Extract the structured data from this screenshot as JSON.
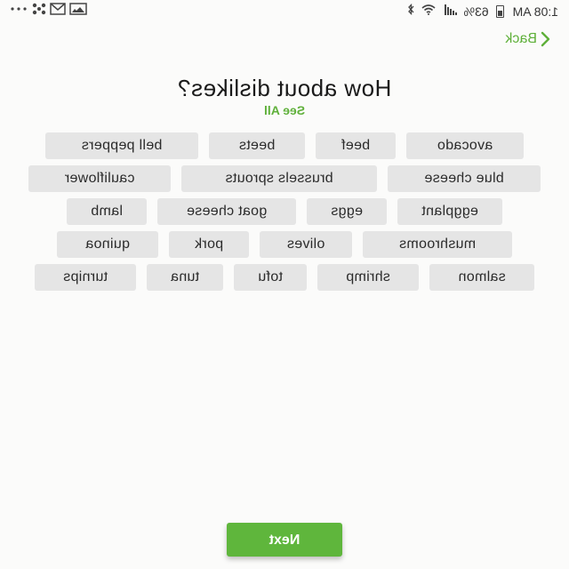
{
  "status_bar": {
    "time": "1:08 AM",
    "battery_percent": "63%",
    "icons": [
      "bluetooth-icon",
      "wifi-icon",
      "signal-icon",
      "battery-icon",
      "gallery-icon",
      "mail-icon",
      "pinwheel-icon",
      "more-icon"
    ]
  },
  "header": {
    "back_label": "Back"
  },
  "title": "How about dislikes?",
  "see_all_label": "See All",
  "chips": [
    "avocado",
    "beef",
    "beets",
    "bell peppers",
    "blue cheese",
    "brussels sprouts",
    "cauliflower",
    "eggplant",
    "eggs",
    "goat cheese",
    "lamb",
    "mushrooms",
    "olives",
    "pork",
    "quinoa",
    "salmon",
    "shrimp",
    "tofu",
    "tuna",
    "turnips"
  ],
  "next_label": "Next",
  "colors": {
    "accent": "#5fb03a",
    "chip_background": "#e5e5e5",
    "page_background": "#fbfbfa"
  }
}
